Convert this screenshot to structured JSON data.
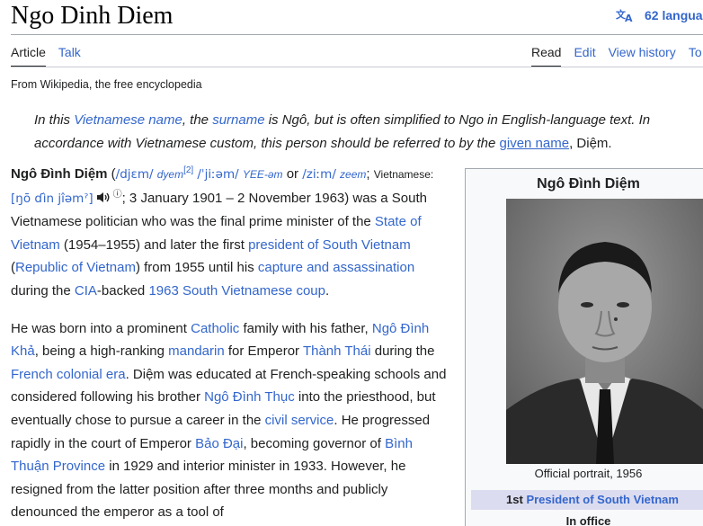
{
  "header": {
    "title": "Ngo Dinh Diem",
    "languages": "62 languag"
  },
  "tabs": {
    "left": [
      "Article",
      "Talk"
    ],
    "right": [
      "Read",
      "Edit",
      "View history",
      "To"
    ]
  },
  "tagline": "From Wikipedia, the free encyclopedia",
  "hatnote": {
    "t1": "In this ",
    "l1": "Vietnamese name",
    "t2": ", the ",
    "l2": "surname",
    "t3": " is Ngô, but is often simplified to Ngo in English-language text. In accordance with Vietnamese custom, this person should be referred to by the ",
    "l3": "given name",
    "t4": ", Diệm."
  },
  "para1": {
    "name": "Ngô Đình Diệm",
    "open": " (",
    "ipa1": "/djɛm/",
    "resp1": "dyem",
    "ref": "[2]",
    "ipa2": "/ˈjiːəm/",
    "resp2": "YEE-əm",
    "or": " or ",
    "ipa3": "/ziːm/",
    "resp3": "zeem",
    "semi": ";",
    "viet_label": "Vietnamese: ",
    "viet_ipa": "[ŋō ɗìn jîəmˀ]",
    "info": "ⓘ",
    "dates": "; 3 January 1901 – 2 November 1963)",
    "t1": " was a South Vietnamese politician who was the final prime minister of the ",
    "l1": "State of Vietnam",
    "t2": " (1954–1955) and later the first ",
    "l2": "president of South Vietnam",
    "t3": " (",
    "l3": "Republic of Vietnam",
    "t4": ") from 1955 until his ",
    "l4": "capture and assassination",
    "t5": " during the ",
    "l5": "CIA",
    "t6": "-backed ",
    "l6": "1963 South Vietnamese coup",
    "t7": "."
  },
  "para2": {
    "t1": "He was born into a prominent ",
    "l1": "Catholic",
    "t2": " family with his father, ",
    "l2": "Ngô Đình Khả",
    "t3": ", being a high-ranking ",
    "l3": "mandarin",
    "t4": " for Emperor ",
    "l4": "Thành Thái",
    "t5": " during the ",
    "l5": "French colonial era",
    "t6": ". Diệm was educated at French-speaking schools and considered following his brother ",
    "l6": "Ngô Đình Thục",
    "t7": " into the priesthood, but eventually chose to pursue a career in the ",
    "l7": "civil service",
    "t8": ". He progressed rapidly in the court of Emperor ",
    "l8": "Bảo Đại",
    "t9": ", becoming governor of ",
    "l9": "Bình Thuận Province",
    "t10": " in 1929 and interior minister in 1933. However, he resigned from the latter position after three months and publicly denounced the emperor as a tool of"
  },
  "infobox": {
    "title": "Ngô Đình Diệm",
    "caption": "Official portrait, 1956",
    "office_ordinal": "1st ",
    "office_link": "President of South Vietnam",
    "in_office": "In office"
  }
}
